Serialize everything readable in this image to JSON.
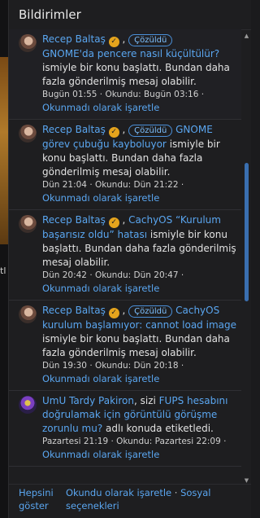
{
  "header": {
    "title": "Bildirimler"
  },
  "background": {
    "fragment_text": "tl"
  },
  "notifications": [
    {
      "user": "Recep Baltaş",
      "badge": "Çözüldü",
      "topic": "GNOME'da pencere nasıl küçültülür?",
      "text": "ismiyle bir konu başlattı. Bundan daha fazla gönderilmiş mesaj olabilir.",
      "meta": "Bugün 01:55 · Okundu: Bugün 03:16 ·",
      "action": "Okunmadı olarak işaretle"
    },
    {
      "user": "Recep Baltaş",
      "badge": "Çözüldü",
      "topic": "GNOME görev çubuğu kayboluyor",
      "text": "ismiyle bir konu başlattı. Bundan daha fazla gönderilmiş mesaj olabilir.",
      "meta": "Dün 21:04 · Okundu: Dün 21:22 ·",
      "action": "Okunmadı olarak işaretle"
    },
    {
      "user": "Recep Baltaş",
      "badge": "",
      "topic": "CachyOS “Kurulum başarısız oldu” hatası",
      "text": "ismiyle bir konu başlattı. Bundan daha fazla gönderilmiş mesaj olabilir.",
      "meta": "Dün 20:42 · Okundu: Dün 20:47 ·",
      "action": "Okunmadı olarak işaretle"
    },
    {
      "user": "Recep Baltaş",
      "badge": "Çözüldü",
      "topic": "CachyOS kurulum başlamıyor: cannot load image",
      "text": "ismiyle bir konu başlattı. Bundan daha fazla gönderilmiş mesaj olabilir.",
      "meta": "Dün 19:30 · Okundu: Dün 20:18 ·",
      "action": "Okunmadı olarak işaretle"
    },
    {
      "user": "UmU Tardy Pakiron",
      "prefix": ", sizi ",
      "topic": "FUPS hesabını doğrulamak için görüntülü görüşme zorunlu mu?",
      "text": "adlı konuda etiketledi.",
      "meta": "Pazartesi 21:19 · Okundu: Pazartesi 22:09 ·",
      "action": "Okunmadı olarak işaretle"
    }
  ],
  "footer": {
    "show_all": "Hepsini göster",
    "mark_read": "Okundu olarak işaretle",
    "separator": " · ",
    "social": "Sosyal seçenekleri"
  },
  "colors": {
    "link": "#5aa6f0",
    "verified": "#e5a41d",
    "badge": "#4a8fd8"
  }
}
